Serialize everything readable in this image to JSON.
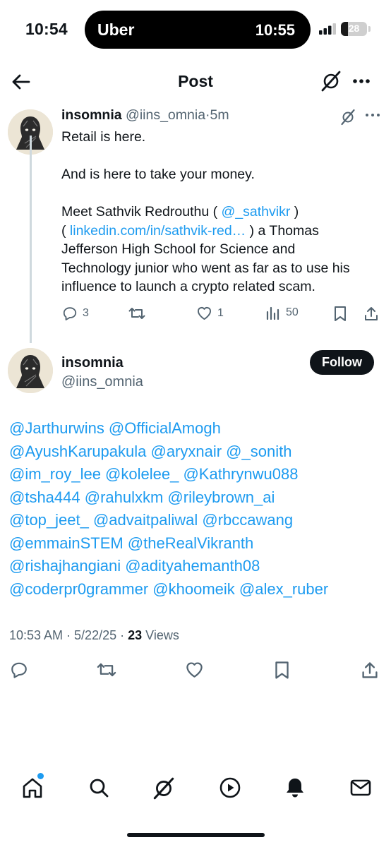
{
  "status_bar": {
    "time": "10:54",
    "activity": {
      "app": "Uber",
      "time": "10:55"
    },
    "battery_level": "28"
  },
  "header": {
    "title": "Post"
  },
  "parent_post": {
    "author_name": "insomnia",
    "handle": "@iins_omnia",
    "separator": "·",
    "time_ago": "5m",
    "lines": {
      "l1": "Retail is here.",
      "l2": "And is here to take your money.",
      "l3a": "Meet Sathvik Redrouthu ( ",
      "l3_mention": "@_sathvikr",
      "l3b": " )",
      "l4a": "( ",
      "l4_link": "linkedin.com/in/sathvik-red…",
      "l4b": " ) a Thomas",
      "l5": "Jefferson High School for Science and",
      "l6": "Technology junior who went as far as to use his",
      "l7": "influence to launch a crypto related scam."
    },
    "metrics": {
      "replies": "3",
      "reposts": "",
      "likes": "1",
      "views": "50"
    }
  },
  "main_post": {
    "author_name": "insomnia",
    "handle": "@iins_omnia",
    "follow_label": "Follow",
    "mention_lines": [
      "@Jarthurwins @OfficialAmogh",
      "@AyushKarupakula @aryxnair @_sonith",
      "@im_roy_lee @kolelee_ @Kathrynwu088",
      "@tsha444 @rahulxkm @rileybrown_ai",
      "@top_jeet_ @advaitpaliwal @rbccawang",
      "@emmainSTEM @theRealVikranth",
      "@rishajhangiani @adityahemanth08",
      "@coderpr0grammer @khoomeik @alex_ruber"
    ],
    "timestamp": "10:53 AM · 5/22/25 · ",
    "views_count": "23",
    "views_label": " Views"
  },
  "colors": {
    "accent": "#1d9bf0",
    "text": "#0f1419",
    "secondary": "#536471",
    "divider": "#cfd9de"
  },
  "icons": {
    "header": [
      "back-arrow-icon",
      "grok-icon",
      "more-icon"
    ],
    "post_actions": [
      "reply-icon",
      "repost-icon",
      "like-icon",
      "views-icon",
      "bookmark-icon",
      "share-icon"
    ],
    "tab_bar": [
      "home-icon",
      "search-icon",
      "grok-icon",
      "video-icon",
      "notifications-icon",
      "messages-icon"
    ]
  }
}
